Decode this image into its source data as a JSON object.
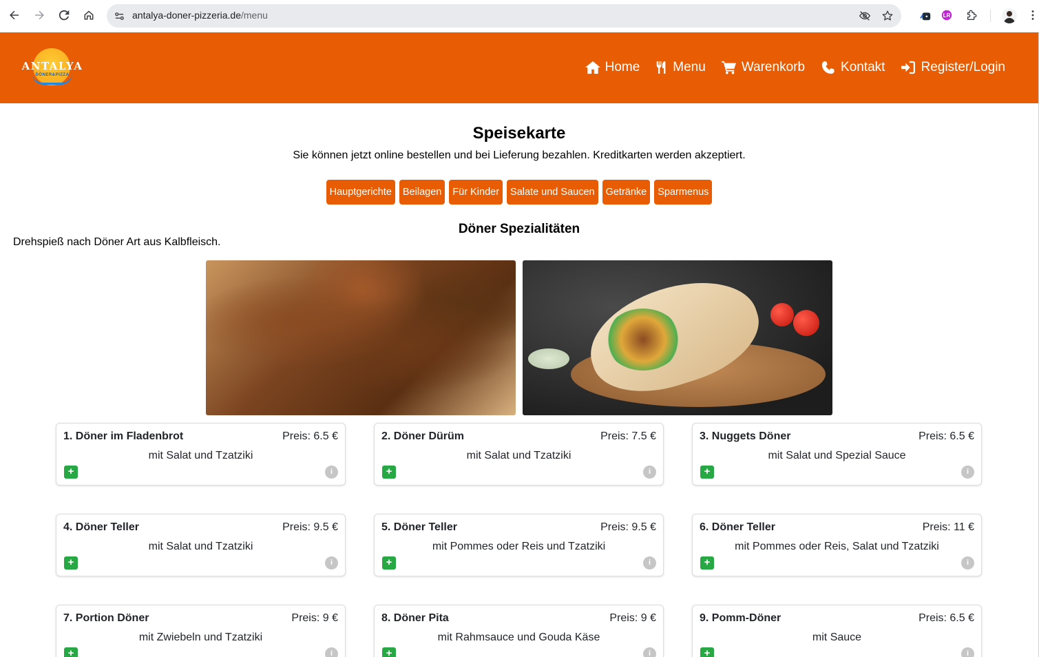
{
  "browser": {
    "url_domain": "antalya-doner-pizzeria.de",
    "url_path": "/menu"
  },
  "header": {
    "logo_text": "ANTALYA",
    "logo_subtext": "DÖNER&PIZZA",
    "nav": [
      {
        "label": "Home",
        "icon": "home-icon"
      },
      {
        "label": "Menu",
        "icon": "utensils-icon"
      },
      {
        "label": "Warenkorb",
        "icon": "cart-icon"
      },
      {
        "label": "Kontakt",
        "icon": "phone-icon"
      },
      {
        "label": "Register/Login",
        "icon": "login-icon"
      }
    ],
    "color": "#e85d04"
  },
  "page": {
    "title": "Speisekarte",
    "subtitle": "Sie können jetzt online bestellen und bei Lieferung bezahlen. Kreditkarten werden akzeptiert."
  },
  "categories": [
    "Hauptgerichte",
    "Beilagen",
    "Für Kinder",
    "Salate und Saucen",
    "Getränke",
    "Sparmenus"
  ],
  "section": {
    "title": "Döner Spezialitäten",
    "description": "Drehspieß nach Döner Art aus Kalbfleisch."
  },
  "items": [
    {
      "name": "1. Döner im Fladenbrot",
      "price": "Preis: 6.5 €",
      "desc": "mit Salat und Tzatziki"
    },
    {
      "name": "2. Döner Dürüm",
      "price": "Preis: 7.5 €",
      "desc": "mit Salat und Tzatziki"
    },
    {
      "name": "3. Nuggets Döner",
      "price": "Preis: 6.5 €",
      "desc": "mit Salat und Spezial Sauce"
    },
    {
      "name": "4. Döner Teller",
      "price": "Preis: 9.5 €",
      "desc": "mit Salat und Tzatziki"
    },
    {
      "name": "5. Döner Teller",
      "price": "Preis: 9.5 €",
      "desc": "mit Pommes oder Reis und Tzatziki"
    },
    {
      "name": "6. Döner Teller",
      "price": "Preis: 11 €",
      "desc": "mit Pommes oder Reis, Salat und Tzatziki"
    },
    {
      "name": "7. Portion Döner",
      "price": "Preis: 9 €",
      "desc": "mit Zwiebeln und Tzatziki"
    },
    {
      "name": "8. Döner Pita",
      "price": "Preis: 9 €",
      "desc": "mit Rahmsauce und Gouda Käse"
    },
    {
      "name": "9. Pomm-Döner",
      "price": "Preis: 6.5 €",
      "desc": "mit Sauce"
    }
  ],
  "buttons": {
    "add": "+",
    "info": "i"
  },
  "colors": {
    "accent": "#e85d04",
    "add_button": "#28a745",
    "info_button": "#c6c6c6"
  }
}
